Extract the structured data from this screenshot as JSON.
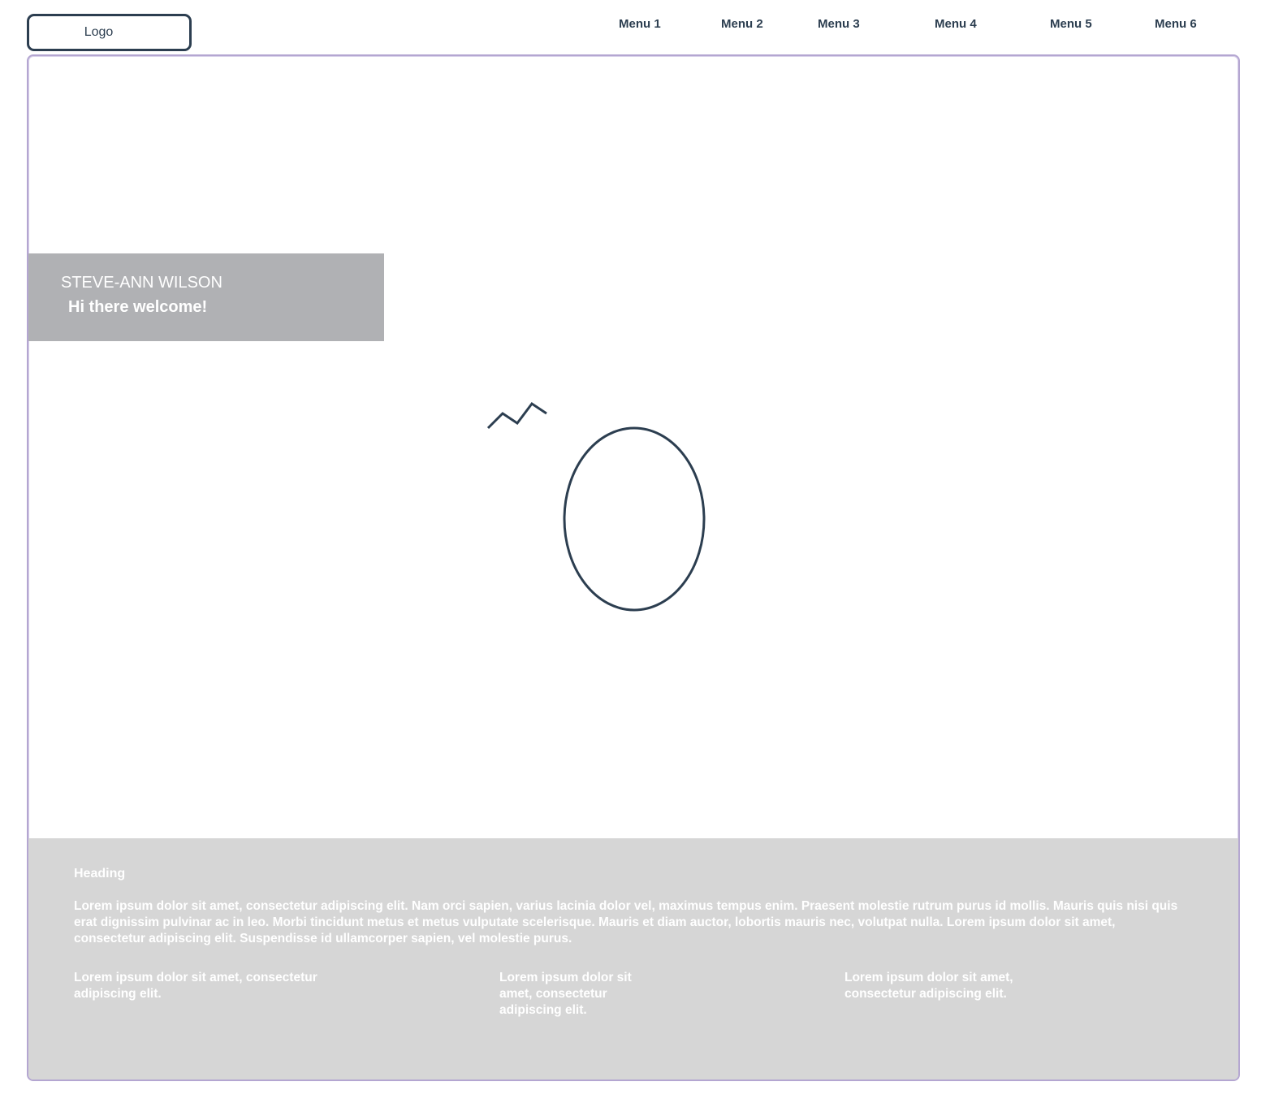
{
  "header": {
    "logo_label": "Logo",
    "menu": [
      {
        "label": "Menu 1"
      },
      {
        "label": "Menu 2"
      },
      {
        "label": "Menu 3"
      },
      {
        "label": "Menu 4"
      },
      {
        "label": "Menu 5"
      },
      {
        "label": "Menu 6"
      }
    ]
  },
  "hero": {
    "name": "STEVE-ANN WILSON",
    "welcome": "Hi there welcome!"
  },
  "footer": {
    "heading": "Heading",
    "body": "Lorem ipsum dolor sit amet, consectetur adipiscing elit. Nam orci sapien, varius lacinia dolor vel, maximus tempus enim. Praesent molestie rutrum purus id mollis. Mauris quis nisi quis erat dignissim pulvinar ac in leo. Morbi tincidunt metus et metus vulputate scelerisque. Mauris et diam auctor, lobortis mauris nec, volutpat nulla. Lorem ipsum dolor sit amet, consectetur adipiscing elit. Suspendisse id ullamcorper sapien, vel molestie purus.",
    "columns": [
      {
        "text": "Lorem ipsum dolor sit amet, consectetur adipiscing elit."
      },
      {
        "text": "Lorem ipsum dolor sit amet, consectetur adipiscing elit."
      },
      {
        "text": "Lorem ipsum dolor sit amet, consectetur adipiscing elit."
      }
    ]
  },
  "colors": {
    "stroke": "#2c3e50",
    "frame_border": "#b4a6d1",
    "hero_box": "#b0b1b4",
    "footer_bg": "#d6d6d6"
  }
}
